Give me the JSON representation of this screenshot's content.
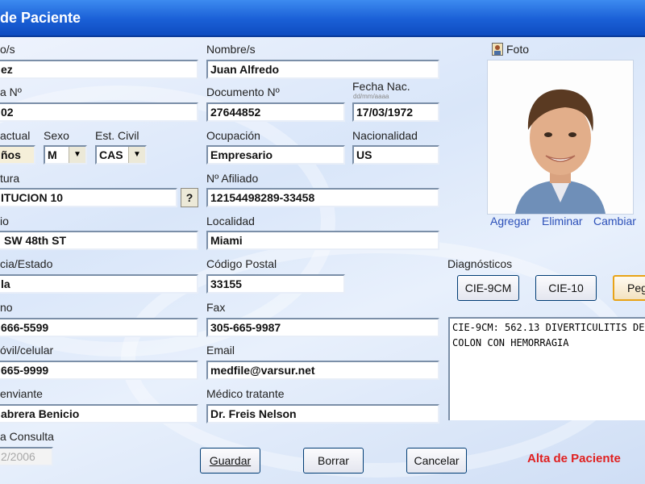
{
  "window": {
    "title": "de Paciente"
  },
  "form": {
    "apellido": {
      "label": "o/s",
      "value": "ez"
    },
    "nombre": {
      "label": "Nombre/s",
      "value": "Juan Alfredo"
    },
    "ficha": {
      "label": "a Nº",
      "value": "02"
    },
    "documento": {
      "label": "Documento Nº",
      "value": "27644852"
    },
    "fecha_nac": {
      "label": "Fecha Nac.",
      "hint": "dd/mm/aaaa",
      "value": "17/03/1972"
    },
    "edad": {
      "label": "actual",
      "value": "ños"
    },
    "sexo": {
      "label": "Sexo",
      "value": "M"
    },
    "estado_civil": {
      "label": "Est. Civil",
      "value": "CAS"
    },
    "ocupacion": {
      "label": "Ocupación",
      "value": "Empresario"
    },
    "nacionalidad": {
      "label": "Nacionalidad",
      "value": "US"
    },
    "cobertura": {
      "label": "tura",
      "value": "ITUCION 10",
      "help_label": "?"
    },
    "afiliado": {
      "label": "Nº Afiliado",
      "value": "12154498289-33458"
    },
    "domicilio": {
      "label": "io",
      "value": "SW 48th ST"
    },
    "localidad": {
      "label": "Localidad",
      "value": "Miami"
    },
    "provincia": {
      "label": "cia/Estado",
      "value": "la"
    },
    "codigo_postal": {
      "label": "Código Postal",
      "value": "33155"
    },
    "telefono": {
      "label": "no",
      "value": "666-5599"
    },
    "fax": {
      "label": "Fax",
      "value": "305-665-9987"
    },
    "movil": {
      "label": "óvil/celular",
      "value": "665-9999"
    },
    "email": {
      "label": "Email",
      "value": "medfile@varsur.net"
    },
    "medico_enviante": {
      "label": "enviante",
      "value": "abrera Benicio"
    },
    "medico_tratante": {
      "label": "Médico tratante",
      "value": "Dr. Freis Nelson"
    },
    "fecha_consulta": {
      "label": "a Consulta",
      "value": "2/2006"
    }
  },
  "photo": {
    "label": "Foto",
    "links": [
      "Agregar",
      "Eliminar",
      "Cambiar"
    ]
  },
  "diagnosticos": {
    "label": "Diagnósticos",
    "buttons": [
      "CIE-9CM",
      "CIE-10",
      "Peg"
    ],
    "text": "CIE-9CM: 562.13 DIVERTICULITIS DE\nCOLON CON HEMORRAGIA"
  },
  "actions": {
    "guardar": "Guardar",
    "borrar": "Borrar",
    "cancelar": "Cancelar"
  },
  "status": "Alta de Paciente",
  "colors": {
    "title_bar": "#1a5fd6",
    "status": "#e02020",
    "link": "#2b4fb8",
    "active_button_border": "#e8a317"
  }
}
